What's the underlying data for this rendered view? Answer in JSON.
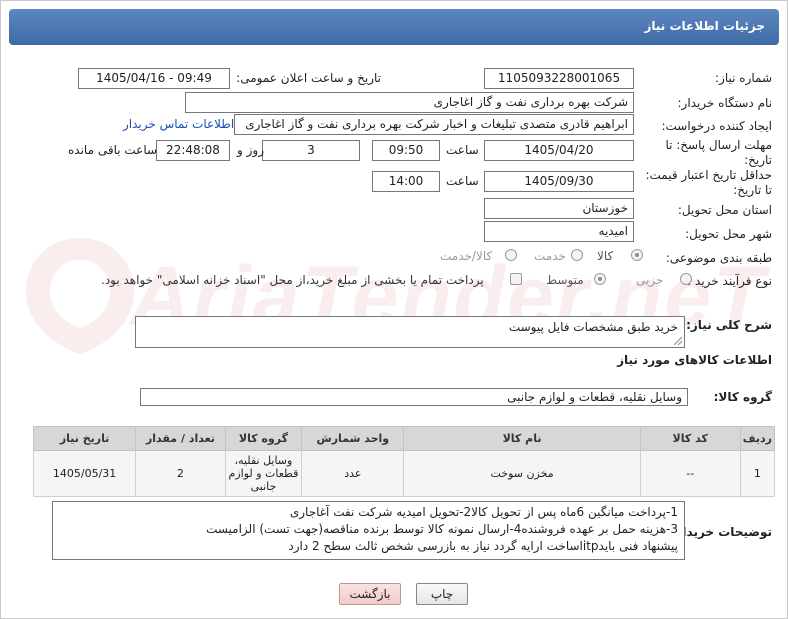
{
  "page": {
    "title": "جزئیات اطلاعات نیاز"
  },
  "watermark": {
    "text": "AriaTender.neT"
  },
  "fields": {
    "need_number": {
      "label": "شماره نیاز:",
      "value": "1105093228001065"
    },
    "announce_datetime": {
      "label": "تاریخ و ساعت اعلان عمومی:",
      "value": "1405/04/16 - 09:49"
    },
    "buyer_org": {
      "label": "نام دستگاه خریدار:",
      "value": "شرکت بهره برداری نفت و گاز اغاجاری"
    },
    "requester": {
      "label": "ایجاد کننده درخواست:",
      "value": "ابراهیم قادری متصدی تبلیغات و اخبار شرکت بهره برداری نفت و گاز اغاجاری",
      "contact_link": "اطلاعات تماس خریدار"
    },
    "reply_deadline": {
      "label": "مهلت ارسال پاسخ: تا تاریخ:",
      "date": "1405/04/20",
      "time_label": "ساعت",
      "time": "09:50",
      "days": "3",
      "days_label": "روز و",
      "remaining": "22:48:08",
      "remaining_label": "ساعت باقی مانده"
    },
    "price_validity": {
      "label": "حداقل تاریخ اعتبار قیمت: تا تاریخ:",
      "date": "1405/09/30",
      "time_label": "ساعت",
      "time": "14:00"
    },
    "province": {
      "label": "استان محل تحویل:",
      "value": "خوزستان"
    },
    "city": {
      "label": "شهر محل تحویل:",
      "value": "امیدیه"
    },
    "category": {
      "label": "طبقه بندی موضوعی:",
      "options": [
        "کالا",
        "خدمت",
        "کالا/خدمت"
      ],
      "selected": "کالا"
    },
    "process_type": {
      "label": "نوع فرآیند خرید :",
      "options": [
        "جزیی",
        "متوسط"
      ],
      "selected": "متوسط",
      "payment_note": "پرداخت تمام یا بخشی از مبلغ خرید،از محل \"اسناد خزانه اسلامی\" خواهد بود."
    }
  },
  "summary": {
    "label": "شرح کلی نیاز:",
    "value": "خرید طبق مشخصات فایل پیوست"
  },
  "goods_section": {
    "title": "اطلاعات کالاهای مورد نیاز",
    "group_label": "گروه کالا:",
    "group_value": "وسایل نقلیه، قطعات و لوازم جانبی",
    "columns": [
      "ردیف",
      "کد کالا",
      "نام کالا",
      "واحد شمارش",
      "گروه کالا",
      "تعداد / مقدار",
      "تاریخ نیاز"
    ],
    "rows": [
      {
        "row": "1",
        "code": "--",
        "name": "مخزن سوخت",
        "unit": "عدد",
        "group_lines": [
          "وسایل نقلیه،",
          "قطعات و لوازم",
          "جانبی"
        ],
        "qty": "2",
        "date": "1405/05/31"
      }
    ]
  },
  "buyer_notes": {
    "label": "توضیحات خریدار:",
    "lines": [
      "1-پرداخت میانگین 6ماه پس از تحویل کالا2-تحویل امیدیه شرکت نفت آغاجاری",
      "3-هزینه حمل بر عهده فروشنده4-ارسال نمونه کالا توسط برنده مناقصه(جهت تست) الزامیست",
      "پیشنهاد فنی بایدitpاساخت ارایه گردد نیاز به بازرسی شخص ثالث سطح 2 دارد"
    ]
  },
  "buttons": {
    "print": "چاپ",
    "back": "بازگشت"
  },
  "colors": {
    "header": "#4a76b1",
    "link": "#1a4fb5",
    "back_button": "#f3c9c9"
  }
}
